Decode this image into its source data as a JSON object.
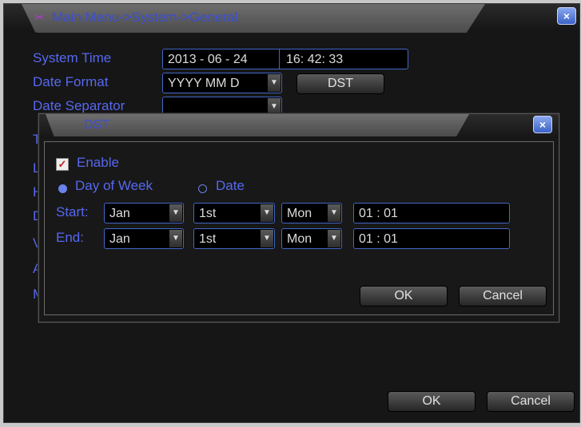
{
  "main": {
    "breadcrumb": "Main Menu->System->General",
    "close_label": "×",
    "labels": {
      "system_time": "System Time",
      "date_format": "Date Format",
      "date_separator": "Date Separator"
    },
    "system_time": {
      "date": "2013 - 06 - 24",
      "time": "16: 42: 33"
    },
    "date_format_value": "YYYY MM D",
    "date_separator_value": "",
    "dst_button": "DST",
    "hidden_initials": [
      "T",
      "L",
      "H",
      "D",
      "V",
      "A",
      "M"
    ],
    "ok_label": "OK",
    "cancel_label": "Cancel"
  },
  "dialog": {
    "title": "DST",
    "close_label": "×",
    "enable_label": "Enable",
    "enable_checked": true,
    "mode_options": [
      "Day of Week",
      "Date"
    ],
    "mode_selected": "Day of Week",
    "start": {
      "label": "Start:",
      "month": "Jan",
      "week": "1st",
      "day": "Mon",
      "time": "01 : 01"
    },
    "end": {
      "label": "End:",
      "month": "Jan",
      "week": "1st",
      "day": "Mon",
      "time": "01 : 01"
    },
    "ok_label": "OK",
    "cancel_label": "Cancel"
  },
  "colors": {
    "label_blue": "#5668f0",
    "field_border": "#4268c6",
    "title_blue": "#3b4ed6"
  }
}
